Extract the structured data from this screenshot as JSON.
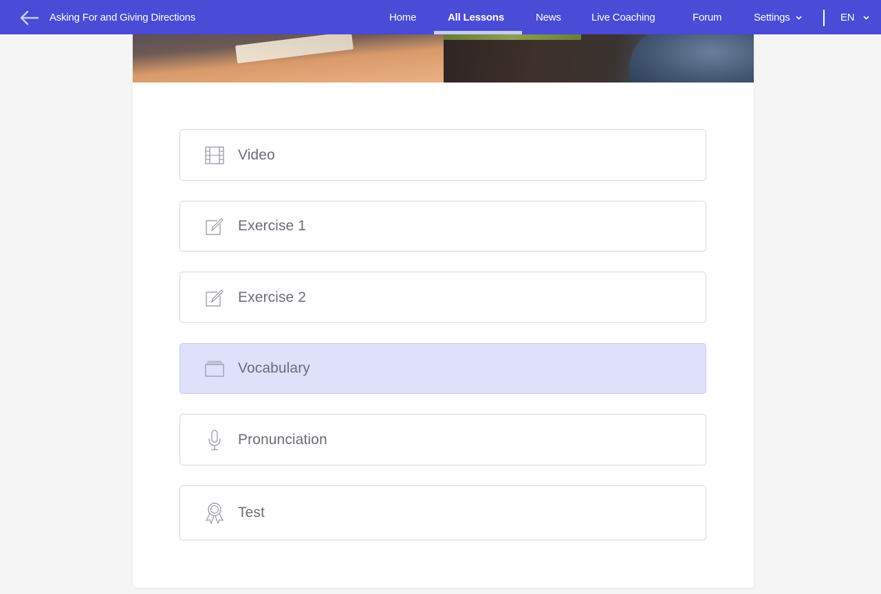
{
  "header": {
    "title": "Asking For and Giving Directions",
    "nav": [
      {
        "label": "Home"
      },
      {
        "label": "All Lessons",
        "active": true
      },
      {
        "label": "News"
      },
      {
        "label": "Live Coaching"
      },
      {
        "label": "Forum"
      },
      {
        "label": "Settings"
      }
    ],
    "language": "EN",
    "colors": {
      "bar": "#4a4bd6",
      "text": "#ffffff"
    }
  },
  "lessons": [
    {
      "label": "Video",
      "icon": "film-icon"
    },
    {
      "label": "Exercise 1",
      "icon": "edit-icon"
    },
    {
      "label": "Exercise 2",
      "icon": "edit-icon"
    },
    {
      "label": "Vocabulary",
      "icon": "cards-icon",
      "active": true
    },
    {
      "label": "Pronunciation",
      "icon": "microphone-icon"
    },
    {
      "label": "Test",
      "icon": "award-icon"
    }
  ],
  "colors": {
    "active_item": "#dfe0fa",
    "item_text": "#6a6b79",
    "item_border": "#d6d7df",
    "page_bg": "#f5f5f6"
  }
}
